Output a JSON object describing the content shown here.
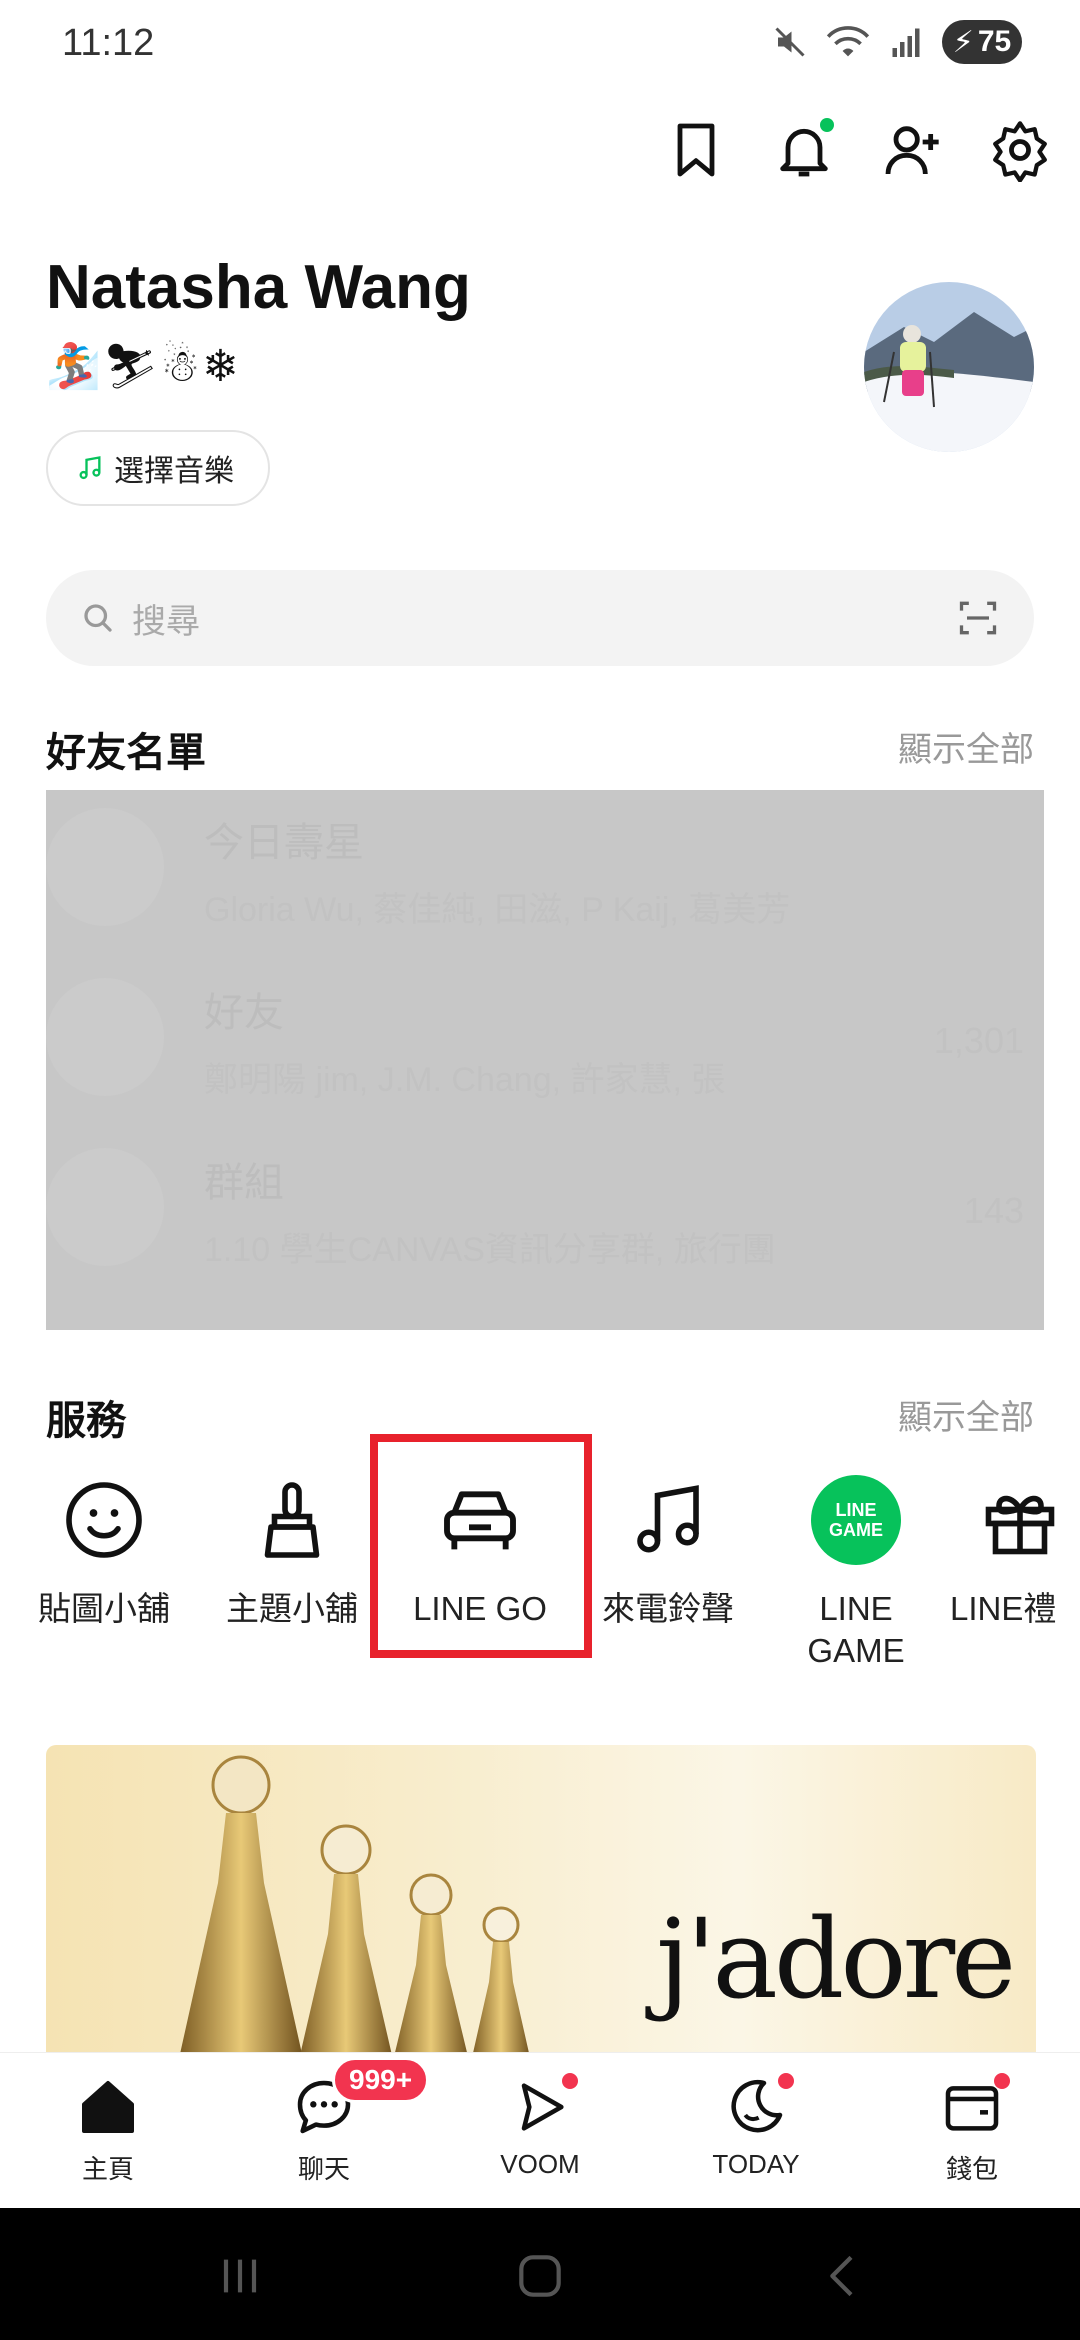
{
  "status_bar": {
    "time": "11:12",
    "battery": "75"
  },
  "top_actions": [
    {
      "name": "bookmark-icon"
    },
    {
      "name": "notification-bell-icon"
    },
    {
      "name": "add-friend-icon"
    },
    {
      "name": "settings-gear-icon"
    }
  ],
  "profile": {
    "name": "Natasha Wang",
    "status_emoji": "🏂⛷☃❄",
    "music_label": "選擇音樂"
  },
  "search": {
    "placeholder": "搜尋"
  },
  "friends_section": {
    "title": "好友名單",
    "show_all": "顯示全部",
    "rows": [
      {
        "title": "今日壽星",
        "subtitle": "Gloria Wu, 蔡佳純, 田滋, P Kaij, 葛美芳",
        "count": ""
      },
      {
        "title": "好友",
        "subtitle": "鄭明陽 jim, J.M. Chang, 許家慧, 張",
        "count": "1,301"
      },
      {
        "title": "群組",
        "subtitle": "1.10 學生CANVAS資訊分享群, 旅行團",
        "count": "143"
      }
    ]
  },
  "services_section": {
    "title": "服務",
    "show_all": "顯示全部",
    "items": [
      {
        "label": "貼圖小舖",
        "icon": "smiley-icon"
      },
      {
        "label": "主題小舖",
        "icon": "paint-brush-icon"
      },
      {
        "label": "LINE GO",
        "icon": "car-icon"
      },
      {
        "label": "來電鈴聲",
        "icon": "music-note-icon"
      },
      {
        "label": "LINE\nGAME",
        "icon": "line-game-icon",
        "icon_text_1": "LINE",
        "icon_text_2": "GAME"
      },
      {
        "label": "LINE禮",
        "icon": "gift-icon"
      }
    ]
  },
  "banner": {
    "text": "j'adore"
  },
  "bottom_nav": [
    {
      "label": "主頁",
      "icon": "home-icon"
    },
    {
      "label": "聊天",
      "icon": "chat-icon",
      "badge": "999+"
    },
    {
      "label": "VOOM",
      "icon": "voom-play-icon"
    },
    {
      "label": "TODAY",
      "icon": "today-moon-icon"
    },
    {
      "label": "錢包",
      "icon": "wallet-icon"
    }
  ],
  "colors": {
    "accent_green": "#07c25b",
    "badge_red": "#f2344f",
    "highlight_red": "#e8222c"
  }
}
